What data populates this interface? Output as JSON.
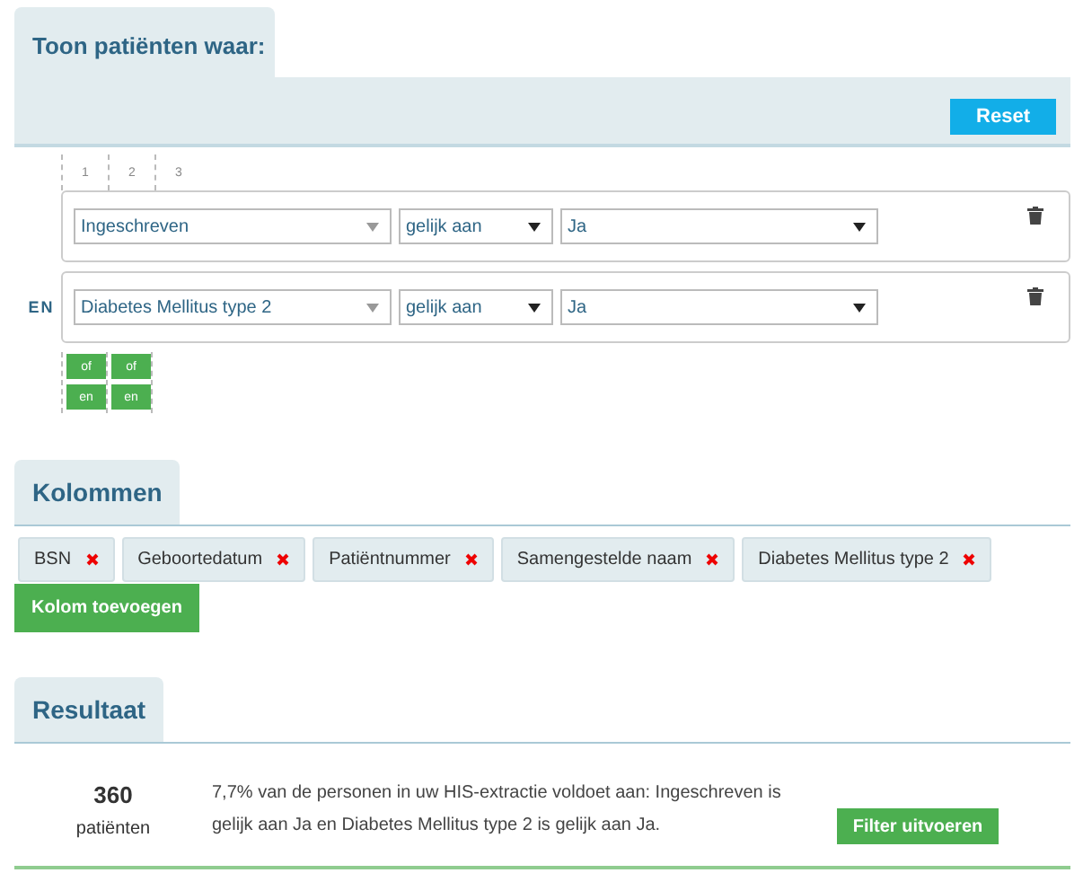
{
  "filter_section": {
    "title": "Toon patiënten waar:",
    "reset_button": "Reset",
    "levels": [
      "1",
      "2",
      "3"
    ],
    "conditions": [
      {
        "field": "Ingeschreven",
        "operator": "gelijk aan",
        "value": "Ja"
      },
      {
        "connector": "EN",
        "field": "Diabetes Mellitus type 2",
        "operator": "gelijk aan",
        "value": "Ja"
      }
    ],
    "level_buttons": [
      {
        "buttons": [
          "of",
          "en"
        ]
      },
      {
        "buttons": [
          "of",
          "en"
        ]
      }
    ]
  },
  "columns_section": {
    "title": "Kolommen",
    "columns": [
      "BSN",
      "Geboortedatum",
      "Patiëntnummer",
      "Samengestelde naam",
      "Diabetes Mellitus type 2"
    ],
    "add_button": "Kolom toevoegen"
  },
  "result_section": {
    "title": "Resultaat",
    "count": "360",
    "count_label": "patiënten",
    "summary": "7,7% van de personen in uw HIS-extractie voldoet aan: Ingeschreven is gelijk aan Ja en Diabetes Mellitus type 2 is gelijk aan Ja.",
    "run_button": "Filter uitvoeren"
  }
}
